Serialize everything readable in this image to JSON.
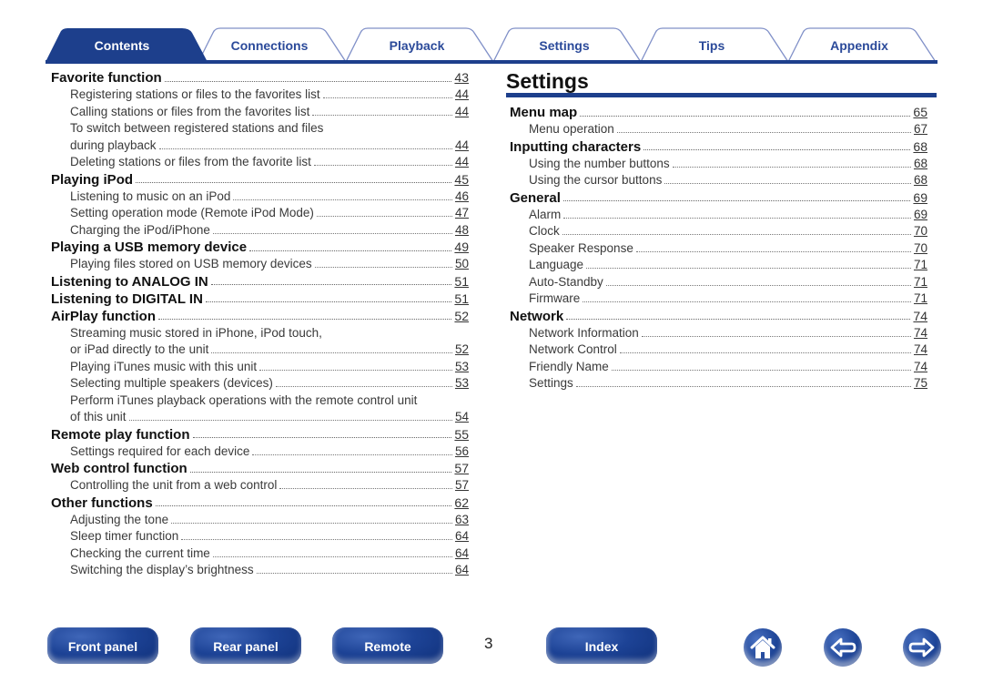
{
  "tabs": [
    {
      "label": "Contents",
      "active": true
    },
    {
      "label": "Connections",
      "active": false
    },
    {
      "label": "Playback",
      "active": false
    },
    {
      "label": "Settings",
      "active": false
    },
    {
      "label": "Tips",
      "active": false
    },
    {
      "label": "Appendix",
      "active": false
    }
  ],
  "colors": {
    "brand_blue": "#1d3f8c",
    "tab_text": "#2b4a9a",
    "tab_outline": "#8090c8"
  },
  "left_toc": [
    {
      "level": 1,
      "label": "Favorite function",
      "page": "43"
    },
    {
      "level": 2,
      "label": "Registering stations or files to the favorites list",
      "page": "44"
    },
    {
      "level": 2,
      "label": "Calling stations or files from the favorites list",
      "page": "44"
    },
    {
      "level": 2,
      "label": "To switch between registered stations and files",
      "page": null
    },
    {
      "level": 2,
      "label": "during playback",
      "page": "44"
    },
    {
      "level": 2,
      "label": "Deleting stations or files from the favorite list",
      "page": "44"
    },
    {
      "level": 1,
      "label": "Playing iPod",
      "page": "45"
    },
    {
      "level": 2,
      "label": "Listening to music on an iPod",
      "page": "46"
    },
    {
      "level": 2,
      "label": "Setting operation mode (Remote iPod Mode)",
      "page": "47"
    },
    {
      "level": 2,
      "label": "Charging the iPod/iPhone",
      "page": "48"
    },
    {
      "level": 1,
      "label": "Playing a USB memory device",
      "page": "49"
    },
    {
      "level": 2,
      "label": "Playing files stored on USB memory devices",
      "page": "50"
    },
    {
      "level": 1,
      "label": "Listening to ANALOG IN",
      "page": "51"
    },
    {
      "level": 1,
      "label": "Listening to DIGITAL IN",
      "page": "51"
    },
    {
      "level": 1,
      "label": "AirPlay function",
      "page": "52"
    },
    {
      "level": 2,
      "label": "Streaming music stored in iPhone, iPod touch,",
      "page": null
    },
    {
      "level": 2,
      "label": "or iPad directly to the unit",
      "page": "52"
    },
    {
      "level": 2,
      "label": "Playing iTunes music with this unit",
      "page": "53"
    },
    {
      "level": 2,
      "label": "Selecting multiple speakers (devices)",
      "page": "53"
    },
    {
      "level": 2,
      "label": "Perform iTunes playback operations with the remote control unit",
      "page": null
    },
    {
      "level": 2,
      "label": "of this unit",
      "page": "54"
    },
    {
      "level": 1,
      "label": "Remote play function",
      "page": "55"
    },
    {
      "level": 2,
      "label": "Settings required for each device",
      "page": "56"
    },
    {
      "level": 1,
      "label": "Web control function",
      "page": "57"
    },
    {
      "level": 2,
      "label": "Controlling the unit from a web control",
      "page": "57"
    },
    {
      "level": 1,
      "label": "Other functions",
      "page": "62"
    },
    {
      "level": 2,
      "label": "Adjusting the tone",
      "page": "63"
    },
    {
      "level": 2,
      "label": "Sleep timer function",
      "page": "64"
    },
    {
      "level": 2,
      "label": "Checking the current time",
      "page": "64"
    },
    {
      "level": 2,
      "label": "Switching the display’s brightness",
      "page": "64"
    }
  ],
  "right_section": {
    "title": "Settings",
    "toc": [
      {
        "level": 1,
        "label": "Menu map",
        "page": "65"
      },
      {
        "level": 2,
        "label": "Menu operation",
        "page": "67"
      },
      {
        "level": 1,
        "label": "Inputting characters",
        "page": "68"
      },
      {
        "level": 2,
        "label": "Using the number buttons",
        "page": "68"
      },
      {
        "level": 2,
        "label": "Using the cursor buttons",
        "page": "68"
      },
      {
        "level": 1,
        "label": "General",
        "page": "69"
      },
      {
        "level": 2,
        "label": "Alarm",
        "page": "69"
      },
      {
        "level": 2,
        "label": "Clock",
        "page": "70"
      },
      {
        "level": 2,
        "label": "Speaker Response",
        "page": "70"
      },
      {
        "level": 2,
        "label": "Language",
        "page": "71"
      },
      {
        "level": 2,
        "label": "Auto-Standby",
        "page": "71"
      },
      {
        "level": 2,
        "label": "Firmware",
        "page": "71"
      },
      {
        "level": 1,
        "label": "Network",
        "page": "74"
      },
      {
        "level": 2,
        "label": "Network Information",
        "page": "74"
      },
      {
        "level": 2,
        "label": "Network Control",
        "page": "74"
      },
      {
        "level": 2,
        "label": "Friendly Name",
        "page": "74"
      },
      {
        "level": 2,
        "label": "Settings",
        "page": "75"
      }
    ]
  },
  "bottom_nav": {
    "front_panel": "Front panel",
    "rear_panel": "Rear panel",
    "remote": "Remote",
    "page_number": "3",
    "index": "Index",
    "home_icon": "home-icon",
    "back_icon": "arrow-left-icon",
    "forward_icon": "arrow-right-icon"
  }
}
